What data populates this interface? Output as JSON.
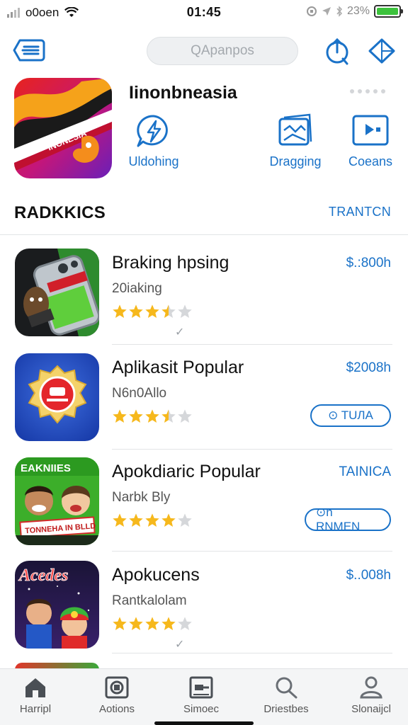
{
  "status_bar": {
    "carrier": "o0oen",
    "time": "01:45",
    "battery": "23%"
  },
  "nav": {
    "search_placeholder": "QApanpos"
  },
  "featured": {
    "title": "Iinonbneasia",
    "icon_text": "INONESIA",
    "categories": [
      {
        "label": "Uldohing",
        "icon": "bolt-message-icon"
      },
      {
        "label": "Dragging",
        "icon": "image-card-icon"
      },
      {
        "label": "Coeans",
        "icon": "video-play-icon"
      }
    ]
  },
  "section": {
    "title": "RADKKICS",
    "link": "TRANTCN"
  },
  "apps": [
    {
      "name": "Braking hpsing",
      "subtitle": "20iaking",
      "rating": 3.5,
      "price": "$.:800h",
      "action": "",
      "check": "✓"
    },
    {
      "name": "Aplikasit Popular",
      "subtitle": "N6n0Allo",
      "rating": 3.5,
      "price": "$2008h",
      "action": "⊙  TUЛA",
      "check": ""
    },
    {
      "name": "Apokdiaric Popular",
      "subtitle": "Narbk Bly",
      "rating": 4,
      "price": "TAINICA",
      "action": "⊙n  RNMEN",
      "check": "",
      "icon_top_text": "EAKNIIES",
      "icon_banner_text": "TONNEHA IN BLLD"
    },
    {
      "name": "Apokucens",
      "subtitle": "Rantkalolam",
      "rating": 4,
      "price": "$..008h",
      "action": "",
      "check": "✓",
      "icon_title_text": "Acedes"
    }
  ],
  "tabs": [
    {
      "label": "Harripl",
      "icon": "home-icon"
    },
    {
      "label": "Aotions",
      "icon": "app-square-icon"
    },
    {
      "label": "Simoec",
      "icon": "screen-icon"
    },
    {
      "label": "Driestbes",
      "icon": "search-icon"
    },
    {
      "label": "Slonaijcl",
      "icon": "person-icon"
    }
  ],
  "colors": {
    "accent": "#1a72c8",
    "star": "#f6b81c",
    "star_empty": "#d5d7da",
    "battery": "#3cc23c"
  }
}
